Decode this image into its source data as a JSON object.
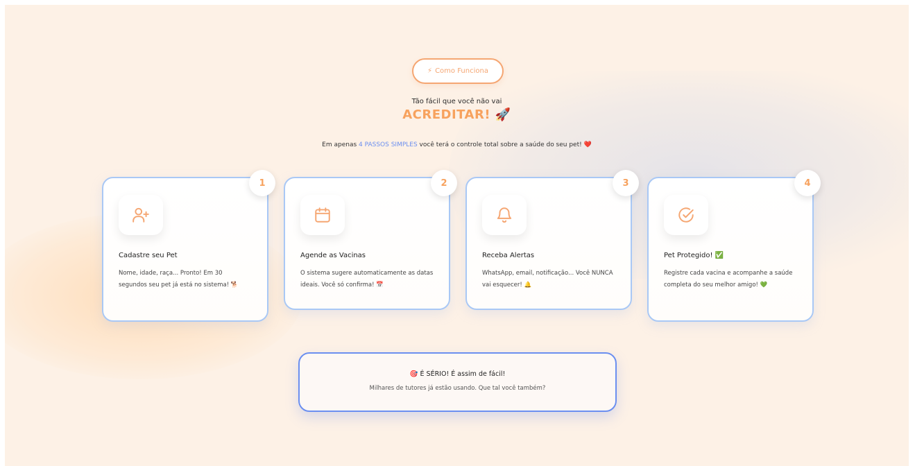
{
  "badge_pill": {
    "icon": "lightning-icon",
    "icon_glyph": "⚡",
    "label": "Como Funciona"
  },
  "hero": {
    "subtitle": "Tão fácil que você não vai",
    "headline": "ACREDITAR!",
    "headline_emoji": "🚀",
    "intro_before": "Em apenas ",
    "intro_highlight": "4 PASSOS SIMPLES",
    "intro_after": " você terá o controle total sobre a saúde do seu pet! ",
    "intro_emoji": "❤️"
  },
  "steps": [
    {
      "number": "1",
      "icon": "user-plus-icon",
      "title": "Cadastre seu Pet",
      "description": "Nome, idade, raça... Pronto! Em 30 segundos seu pet já está no sistema! 🐕"
    },
    {
      "number": "2",
      "icon": "calendar-icon",
      "title": "Agende as Vacinas",
      "description": "O sistema sugere automaticamente as datas ideais. Você só confirma! 📅"
    },
    {
      "number": "3",
      "icon": "bell-icon",
      "title": "Receba Alertas",
      "description": "WhatsApp, email, notificação... Você NUNCA vai esquecer! 🔔"
    },
    {
      "number": "4",
      "icon": "check-circle-icon",
      "title": "Pet Protegido! ✅",
      "description": "Registre cada vacina e acompanhe a saúde completa do seu melhor amigo! 💚"
    }
  ],
  "cta": {
    "title": "🎯 É SÉRIO! É assim de fácil!",
    "description": "Milhares de tutores já estão usando. Que tal você também?"
  },
  "colors": {
    "accent_orange": "#f7a25e",
    "accent_blue": "#6b8ff0",
    "card_border": "#a9c8f5",
    "background": "#fdf1e6"
  }
}
